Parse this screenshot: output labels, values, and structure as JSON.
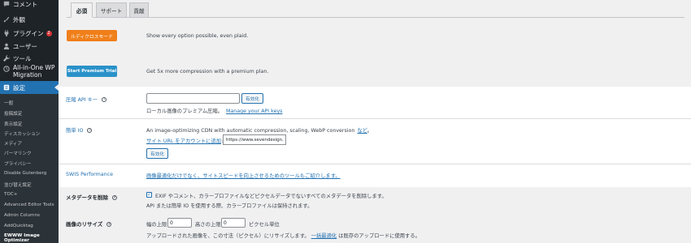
{
  "sidebar": {
    "items": [
      {
        "label": "コメント",
        "icon": "comment-icon"
      },
      {
        "label": "外観",
        "icon": "paintbrush-icon"
      },
      {
        "label": "プラグイン",
        "icon": "plugin-icon",
        "badge": "2"
      },
      {
        "label": "ユーザー",
        "icon": "user-icon"
      },
      {
        "label": "ツール",
        "icon": "wrench-icon"
      },
      {
        "label": "All-in-One WP Migration",
        "icon": "migration-icon"
      }
    ],
    "active": {
      "label": "設定",
      "icon": "settings-icon"
    },
    "submenu": [
      "一般",
      "投稿設定",
      "表示設定",
      "ディスカッション",
      "メディア",
      "パーマリンク",
      "プライバシー",
      "Disable Gutenberg",
      "並び替え設定",
      "TOC+",
      "Advanced Editor Tools",
      "Admin Columns",
      "AddQuicktag",
      "EWWW Image Optimizer"
    ]
  },
  "tabs": [
    "必須",
    "サポート",
    "貢献"
  ],
  "promo": {
    "ludicrous_button": "ルディクロスモード",
    "ludicrous_desc": "Show every option possible, even plaid.",
    "premium_button": "Start Premium Trial",
    "premium_desc": "Get 5x more compression with a premium plan."
  },
  "api": {
    "label": "圧縮 API キー",
    "input_value": "",
    "activate_button": "有効化",
    "desc": "ローカル画像のプレミアム圧縮。",
    "link": "Manage your API keys"
  },
  "easy_io": {
    "label": "簡単 IO",
    "desc": "An image-optimizing CDN with automatic compression, scaling, WebP conversion",
    "more_link": "など",
    "site_link": "サイト URL をアカウントに追加",
    "site_url": "https://www.sevendesign.",
    "activate_button": "有効化"
  },
  "swis": {
    "label": "SWIS Performance",
    "link": "画像最適化だけでなく、サイトスピードを向上させるためのツールもご紹介します。"
  },
  "metadata": {
    "label": "メタデータを削除",
    "checked": true,
    "desc": "EXIF やコメント、カラープロファイルなどピクセルデータでないすべてのメタデータを削除します。",
    "note": "API または簡単 IO を使用する際、カラープロファイルは保持されます。"
  },
  "resize": {
    "label": "画像のリサイズ",
    "width_label": "幅の上限",
    "width_value": "0",
    "height_label": "高さの上限",
    "height_value": "0",
    "unit": "ピクセル単位",
    "desc_before": "アップロードされた画像を、この寸法（ピクセル）にリサイズします。",
    "bulk_link": "一括最適化",
    "desc_after": "は既存のアップロードに使用する。"
  }
}
